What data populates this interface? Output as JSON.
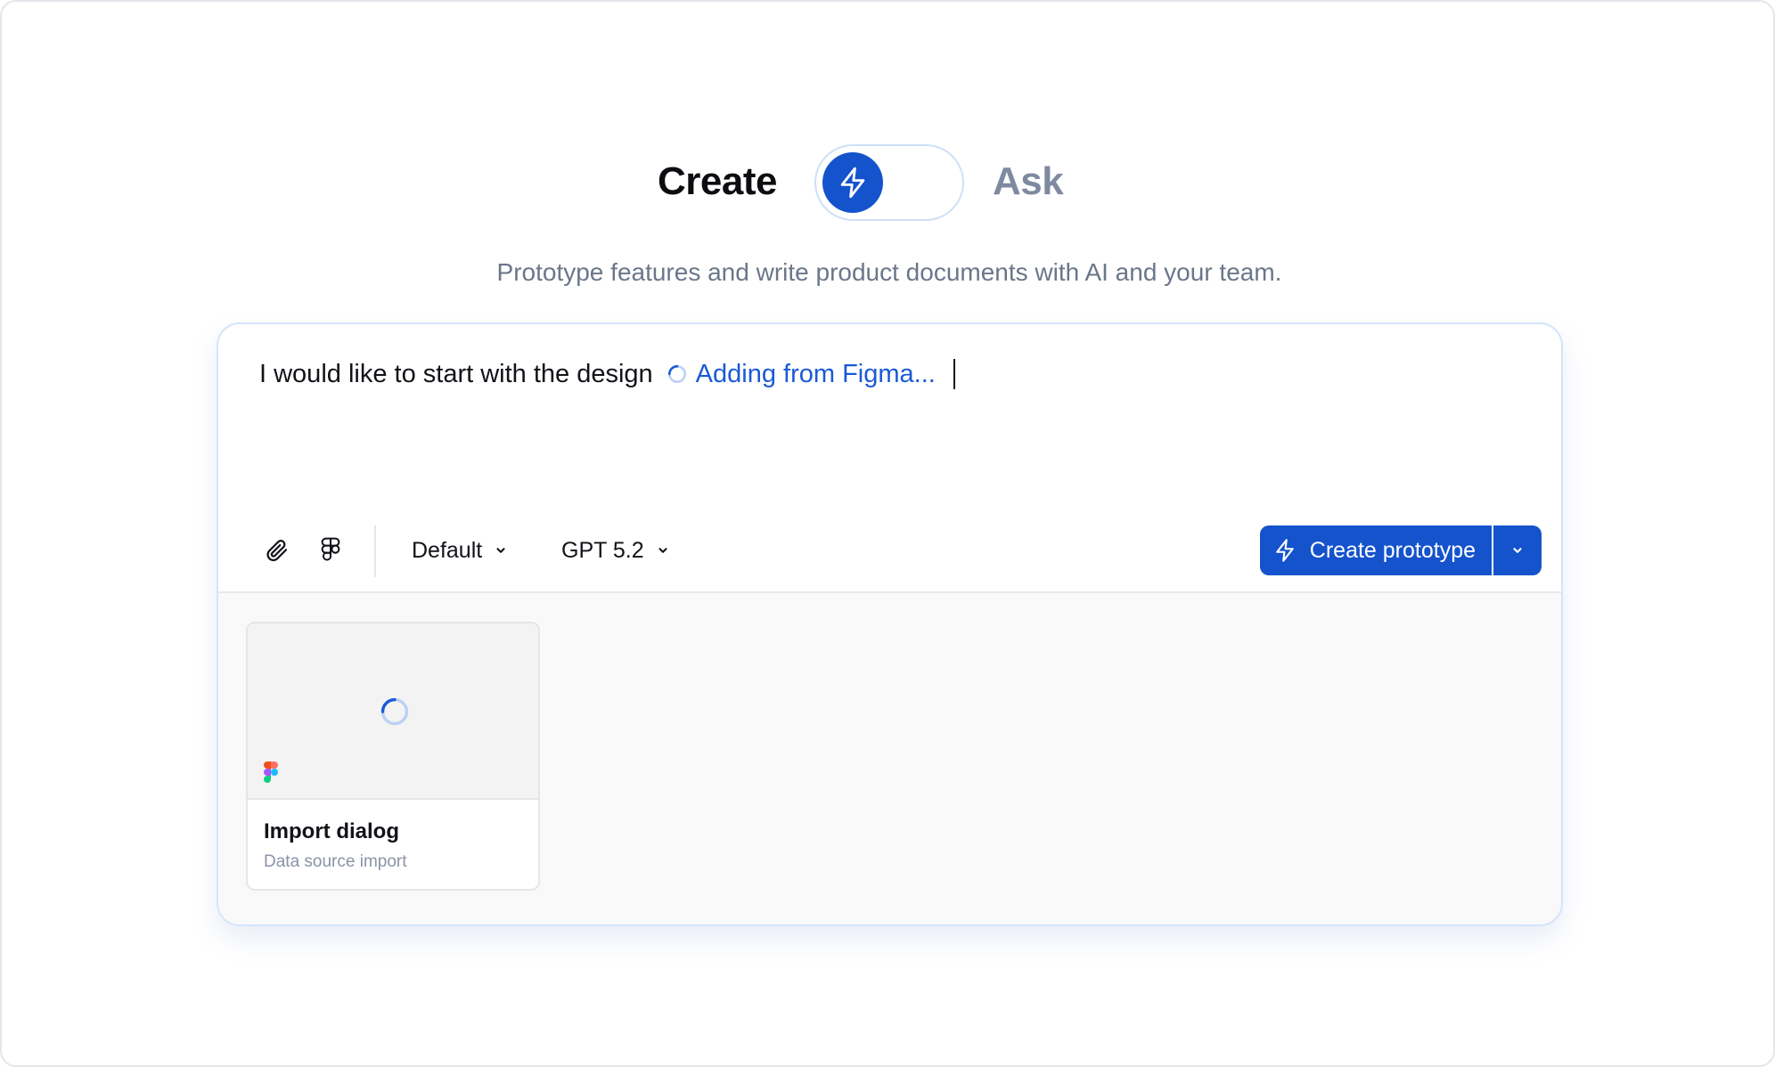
{
  "mode": {
    "create_label": "Create",
    "ask_label": "Ask",
    "active": "create",
    "toggle_icon": "lightning-icon"
  },
  "subtitle": "Prototype features and write product documents with AI and your team.",
  "prompt": {
    "text": "I would like to start with the design",
    "status_text": "Adding from Figma...",
    "status_icon": "spinner-icon"
  },
  "toolbar": {
    "attach_icon": "paperclip-icon",
    "figma_icon": "figma-icon",
    "style_select": "Default",
    "model_select": "GPT 5.2",
    "primary_label": "Create prototype",
    "primary_icon": "lightning-icon",
    "split_icon": "chevron-down-icon"
  },
  "attachments": [
    {
      "title": "Import dialog",
      "subtitle": "Data source import",
      "source_icon": "figma-logo-icon",
      "state": "loading"
    }
  ],
  "colors": {
    "accent": "#1553cc",
    "link": "#1a5ad6",
    "muted": "#7f8aa0",
    "card_border": "#d4e4fb"
  }
}
